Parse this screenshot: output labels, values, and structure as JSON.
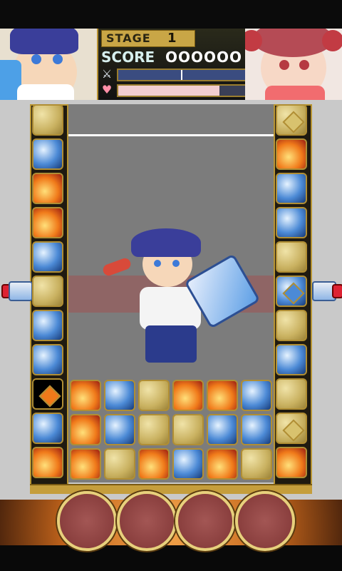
{
  "hud": {
    "stage_label": "STAGE",
    "stage_value": "1",
    "score_label": "SCORE",
    "score_value": "OOOOOO",
    "sword_meter": 1.0,
    "heart_meter": 0.8
  },
  "icons": {
    "sword": "sword-icon",
    "heart": "heart-icon"
  },
  "colors": {
    "frame_gold": "#b89533",
    "rock": "#c9b160",
    "water": "#4c8ad6",
    "fire": "#f07a1a"
  },
  "board": {
    "left_column": [
      "rock",
      "water",
      "fire",
      "fire",
      "water",
      "rock",
      "water",
      "water",
      "gem-fire",
      "water",
      "fire"
    ],
    "right_column": [
      "gem-rock",
      "fire",
      "water",
      "water",
      "rock",
      "gem-water",
      "rock",
      "water",
      "rock",
      "gem-rock",
      "fire"
    ],
    "rows": [
      [
        "fire",
        "water",
        "rock",
        "fire",
        "fire",
        "water"
      ],
      [
        "fire",
        "water",
        "rock",
        "rock",
        "water",
        "water"
      ],
      [
        "fire",
        "rock",
        "fire",
        "water",
        "fire",
        "rock"
      ]
    ]
  },
  "slots": [
    "slot-1",
    "slot-2",
    "slot-3",
    "slot-4"
  ]
}
